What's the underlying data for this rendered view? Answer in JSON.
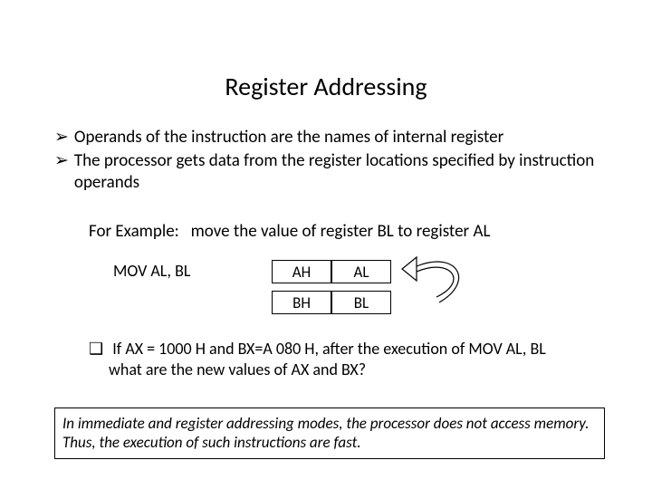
{
  "title": "Register Addressing",
  "bullets": [
    "Operands of the instruction are the names of internal register",
    "The processor gets data from the register locations specified by instruction operands"
  ],
  "example_label": "For Example:",
  "example_text": "move the value of register BL to register AL",
  "instruction": "MOV AL, BL",
  "registers": {
    "row1": {
      "high": "AH",
      "low": "AL"
    },
    "row2": {
      "high": "BH",
      "low": "BL"
    }
  },
  "question_lines": [
    "If AX = 1000 H and BX=A 080 H, after the execution of MOV AL, BL",
    "what are the new values of AX and BX?"
  ],
  "note_lines": [
    "In immediate and register addressing modes, the processor does not access memory.",
    "Thus, the execution of such instructions are fast."
  ],
  "glyphs": {
    "arrow_bullet": "➢",
    "square_bullet": "❑"
  }
}
